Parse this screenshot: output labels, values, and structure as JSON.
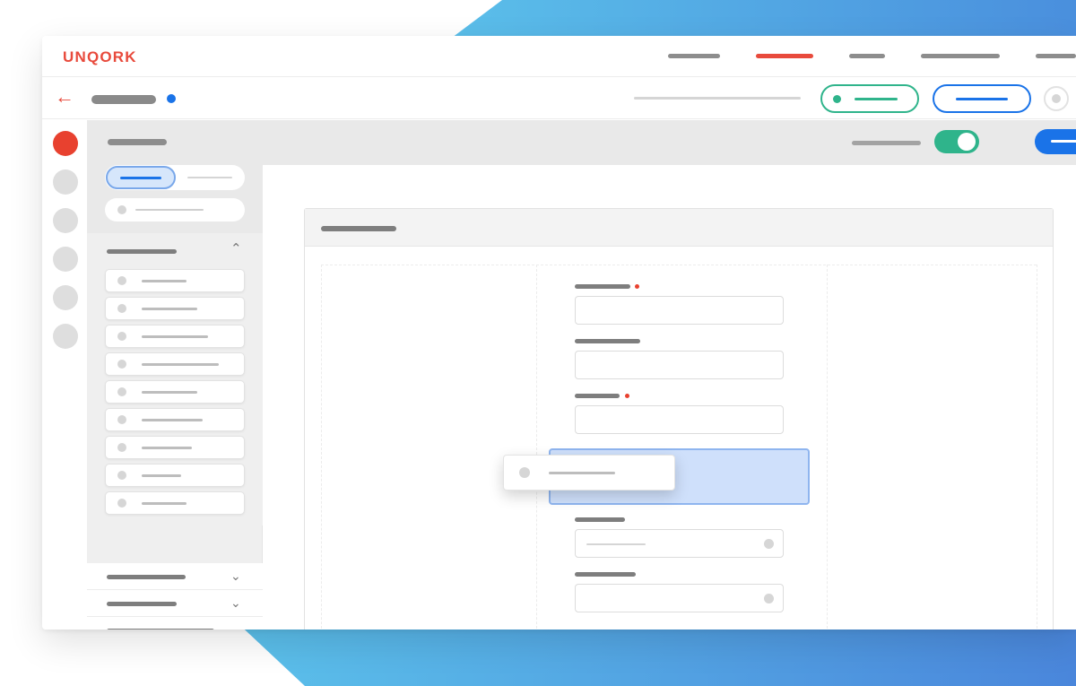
{
  "app": {
    "logo_text": "UNQORK"
  },
  "colors": {
    "brand_red": "#e84a3c",
    "accent_blue": "#1a73e8",
    "accent_green": "#2fb48b",
    "dropzone_blue": "#cfe0fb"
  },
  "icons": {
    "back": "left-arrow-icon",
    "collapse": "chevron-up-icon",
    "expand": "chevron-down-icon"
  },
  "toolbar": {
    "back_glyph": "←"
  },
  "sidebar_rail": {
    "active_index": 0,
    "count": 6
  },
  "header_band": {
    "toggle_on": true,
    "dropdown_glyph": "⌄"
  },
  "palette": {
    "active_tab_index": 0,
    "open_group": {
      "caret_glyph": "⌃",
      "item_count": 9
    },
    "closed_group_glyph": "⌄"
  },
  "form": {
    "required_fields": [
      0,
      2
    ]
  }
}
